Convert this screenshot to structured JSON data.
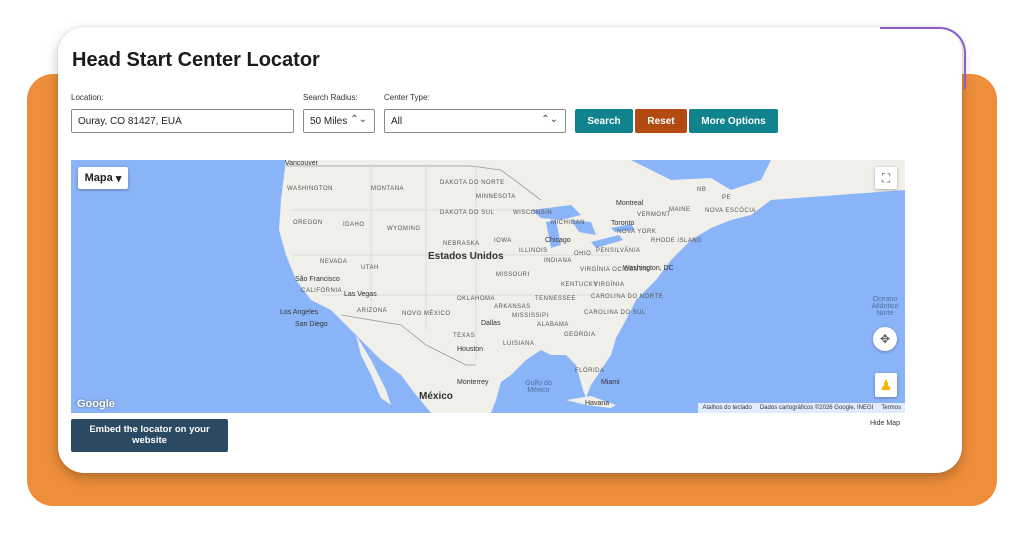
{
  "page_title": "Head Start Center Locator",
  "form": {
    "location_label": "Location:",
    "location_value": "Ouray, CO 81427, EUA",
    "radius_label": "Search Radius:",
    "radius_value": "50 Miles",
    "type_label": "Center Type:",
    "type_value": "All"
  },
  "buttons": {
    "search": "Search",
    "reset": "Reset",
    "more": "More Options",
    "embed": "Embed the locator on your website",
    "hide_map": "Hide Map"
  },
  "colors": {
    "orange": "#ef8e3a",
    "teal": "#11838e",
    "rust": "#b24a12",
    "navy": "#2a4a63"
  },
  "map": {
    "type_button": "Mapa",
    "fullscreen_icon": "fullscreen-icon",
    "pan_icon": "pan-icon",
    "pegman_icon": "pegman-icon",
    "logo": "Google",
    "footer": {
      "shortcuts": "Atalhos do teclado",
      "data": "Dados cartográficos ©2026 Google, INEGI",
      "terms": "Termos"
    },
    "country_labels": {
      "usa": "Estados Unidos",
      "mexico": "México"
    },
    "ocean_labels": {
      "atlantic": "Oceano Atlântico Norte",
      "gulf": "Golfo do México"
    },
    "state_labels": [
      "WASHINGTON",
      "MONTANA",
      "DAKOTA DO NORTE",
      "MINNESOTA",
      "OREGON",
      "IDAHO",
      "WYOMING",
      "DAKOTA DO SUL",
      "WISCONSIN",
      "MICHIGAN",
      "NEBRASKA",
      "IOWA",
      "ILLINOIS",
      "INDIANA",
      "OHIO",
      "PENSILVÂNIA",
      "NEVADA",
      "UTAH",
      "CALIFÓRNIA",
      "MISSOURI",
      "VIRGÍNIA OCIDENTAL",
      "VIRGÍNIA",
      "KENTUCKY",
      "ARIZONA",
      "NOVO MÉXICO",
      "OKLAHOMA",
      "ARKANSAS",
      "TENNESSEE",
      "CAROLINA DO NORTE",
      "CAROLINA DO SUL",
      "MISSISSIPI",
      "ALABAMA",
      "GEÓRGIA",
      "TEXAS",
      "LUISIANA",
      "FLÓRIDA",
      "NOVA YORK",
      "VERMONT",
      "MAINE",
      "NOVA ESCÓCIA",
      "RHODE ISLAND",
      "NB",
      "PE"
    ],
    "city_labels": [
      "Vancouver",
      "São Francisco",
      "Las Vegas",
      "Los Angeles",
      "San Diego",
      "Chicago",
      "Toronto",
      "Montreal",
      "Washington, DC",
      "Dallas",
      "Houston",
      "Monterrey",
      "Miami",
      "Havana"
    ]
  }
}
